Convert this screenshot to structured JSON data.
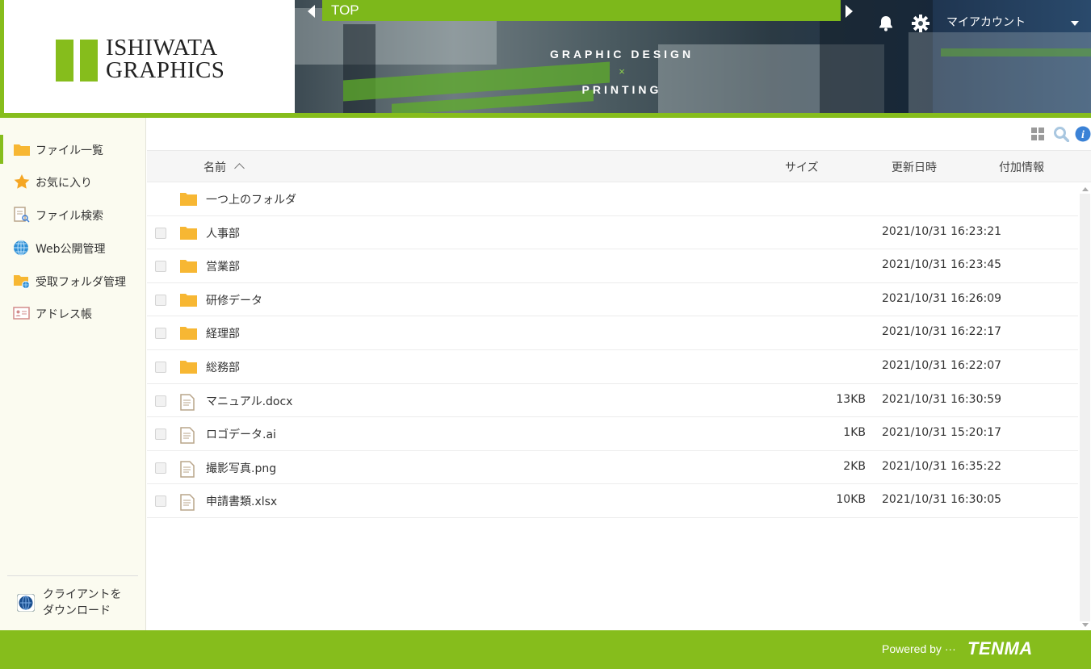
{
  "brand": {
    "logo_line1": "ISHIWATA",
    "logo_line2": "GRAPHICS",
    "tagline_top": "GRAPHIC DESIGN",
    "tagline_x": "×",
    "tagline_bottom": "PRINTING",
    "accent": "#86bd1c"
  },
  "header": {
    "breadcrumb": "TOP",
    "account_label": "マイアカウント"
  },
  "sidebar": {
    "items": [
      {
        "label": "ファイル一覧",
        "icon": "folder-icon"
      },
      {
        "label": "お気に入り",
        "icon": "star-icon"
      },
      {
        "label": "ファイル検索",
        "icon": "file-search-icon"
      },
      {
        "label": "Web公開管理",
        "icon": "globe-icon"
      },
      {
        "label": "受取フォルダ管理",
        "icon": "folder-globe-icon"
      },
      {
        "label": "アドレス帳",
        "icon": "address-card-icon"
      }
    ],
    "client_download_line1": "クライアントを",
    "client_download_line2": "ダウンロード"
  },
  "table": {
    "headers": {
      "name": "名前",
      "size": "サイズ",
      "modified": "更新日時",
      "info": "付加情報"
    },
    "parent_folder": "一つ上のフォルダ",
    "rows": [
      {
        "type": "folder",
        "name": "人事部",
        "size": "",
        "modified": "2021/10/31 16:23:21"
      },
      {
        "type": "folder",
        "name": "営業部",
        "size": "",
        "modified": "2021/10/31 16:23:45"
      },
      {
        "type": "folder",
        "name": "研修データ",
        "size": "",
        "modified": "2021/10/31 16:26:09"
      },
      {
        "type": "folder",
        "name": "経理部",
        "size": "",
        "modified": "2021/10/31 16:22:17"
      },
      {
        "type": "folder",
        "name": "総務部",
        "size": "",
        "modified": "2021/10/31 16:22:07"
      },
      {
        "type": "file",
        "name": "マニュアル.docx",
        "size": "13KB",
        "modified": "2021/10/31 16:30:59"
      },
      {
        "type": "file",
        "name": "ロゴデータ.ai",
        "size": "1KB",
        "modified": "2021/10/31 15:20:17"
      },
      {
        "type": "file",
        "name": "撮影写真.png",
        "size": "2KB",
        "modified": "2021/10/31 16:35:22"
      },
      {
        "type": "file",
        "name": "申請書類.xlsx",
        "size": "10KB",
        "modified": "2021/10/31 16:30:05"
      }
    ]
  },
  "footer": {
    "powered_by": "Powered by ···",
    "vendor": "TENMA"
  }
}
